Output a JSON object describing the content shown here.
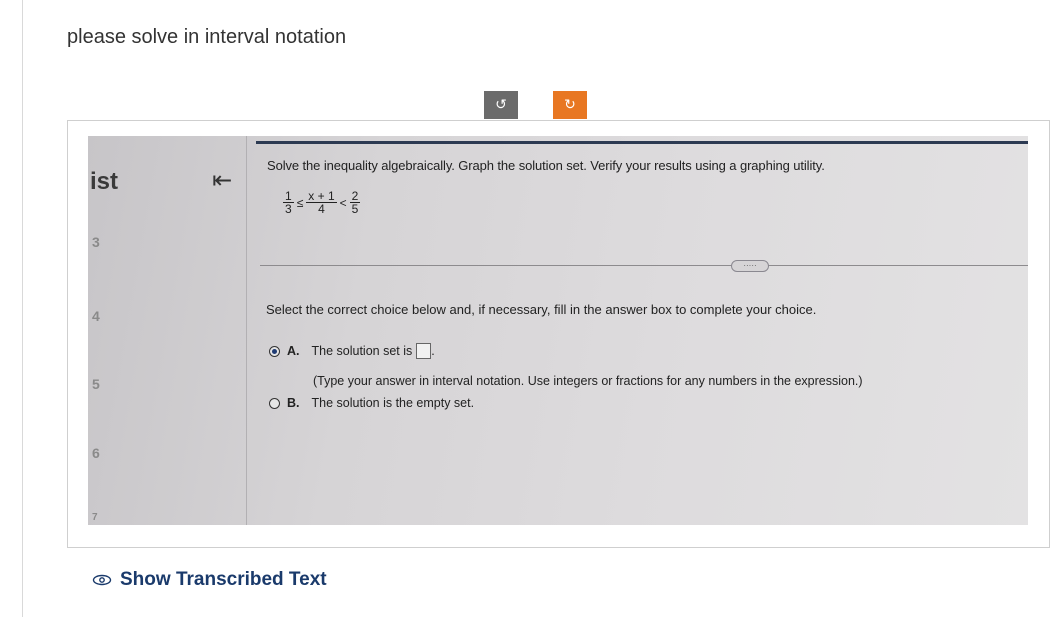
{
  "question": "please solve in interval notation",
  "toolbar": {
    "rotate_left_icon": "rotate-left-icon",
    "rotate_right_icon": "rotate-right-icon"
  },
  "photo": {
    "sidebar": {
      "title": "ist",
      "numbers": [
        "3",
        "4",
        "5",
        "6",
        "7"
      ]
    },
    "collapse_icon": "collapse-left-icon",
    "instruction": "Solve the inequality algebraically. Graph the solution set. Verify your results using a graphing utility.",
    "inequality": {
      "left_num": "1",
      "left_den": "3",
      "op1": "≤",
      "mid_num": "x + 1",
      "mid_den": "4",
      "op2": "<",
      "right_num": "2",
      "right_den": "5"
    },
    "more_label": "·····",
    "select_text": "Select the correct choice below and, if necessary, fill in the answer box to complete your choice.",
    "options": [
      {
        "letter": "A.",
        "text": "The solution set is",
        "suffix": ".",
        "selected": true
      },
      {
        "letter": "B.",
        "text": "The solution is the empty set.",
        "selected": false
      }
    ],
    "hint": "(Type your answer in interval notation. Use integers or fractions for any numbers in the expression.)"
  },
  "show_transcribed": "Show Transcribed Text",
  "colors": {
    "accent": "#e87722",
    "link": "#1a3a6b",
    "rotate_btn": "#6b6b6b"
  }
}
